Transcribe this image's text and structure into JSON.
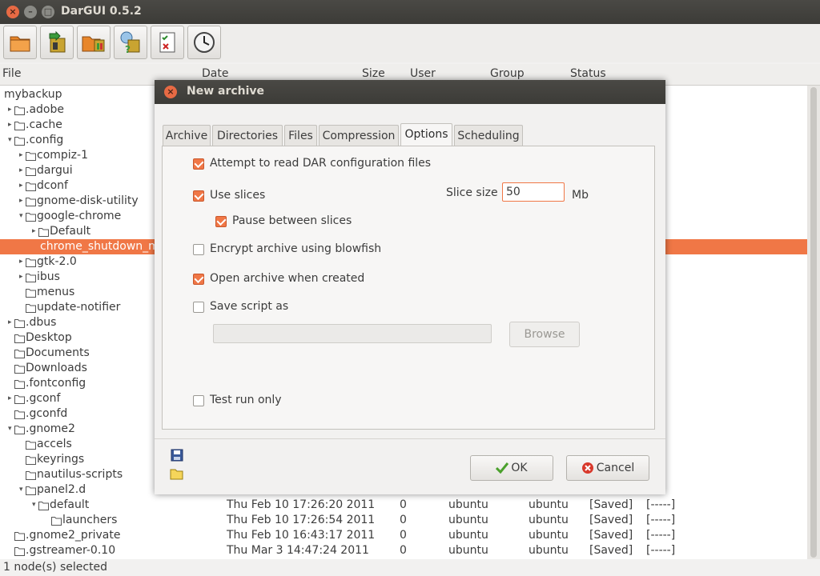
{
  "window": {
    "title": "DarGUI 0.5.2"
  },
  "toolbar": {
    "buttons": [
      "folder-icon",
      "archive-extract-icon",
      "folder-archive-icon",
      "compare-icon",
      "checklist-icon",
      "clock-icon"
    ]
  },
  "columns": {
    "file": "File",
    "date": "Date",
    "size": "Size",
    "user": "User",
    "group": "Group",
    "status": "Status"
  },
  "tree": {
    "root": "mybackup",
    "rows": [
      {
        "name": ".adobe",
        "level": 1,
        "arrow": true
      },
      {
        "name": ".cache",
        "level": 1,
        "arrow": true
      },
      {
        "name": ".config",
        "level": 1,
        "arrow": true,
        "open": true
      },
      {
        "name": "compiz-1",
        "level": 2,
        "arrow": true
      },
      {
        "name": "dargui",
        "level": 2,
        "arrow": true
      },
      {
        "name": "dconf",
        "level": 2,
        "arrow": true
      },
      {
        "name": "gnome-disk-utility",
        "level": 2,
        "arrow": true
      },
      {
        "name": "google-chrome",
        "level": 2,
        "arrow": true,
        "open": true
      },
      {
        "name": "Default",
        "level": 3,
        "arrow": true
      },
      {
        "name": "chrome_shutdown_m",
        "level": 3,
        "arrow": false,
        "selected": true,
        "file": true
      },
      {
        "name": "gtk-2.0",
        "level": 2,
        "arrow": true
      },
      {
        "name": "ibus",
        "level": 2,
        "arrow": true
      },
      {
        "name": "menus",
        "level": 2,
        "arrow": false
      },
      {
        "name": "update-notifier",
        "level": 2,
        "arrow": false
      },
      {
        "name": ".dbus",
        "level": 1,
        "arrow": true
      },
      {
        "name": "Desktop",
        "level": 1,
        "arrow": false
      },
      {
        "name": "Documents",
        "level": 1,
        "arrow": false
      },
      {
        "name": "Downloads",
        "level": 1,
        "arrow": false
      },
      {
        "name": ".fontconfig",
        "level": 1,
        "arrow": false
      },
      {
        "name": ".gconf",
        "level": 1,
        "arrow": true
      },
      {
        "name": ".gconfd",
        "level": 1,
        "arrow": false
      },
      {
        "name": ".gnome2",
        "level": 1,
        "arrow": true,
        "open": true
      },
      {
        "name": "accels",
        "level": 2,
        "arrow": false
      },
      {
        "name": "keyrings",
        "level": 2,
        "arrow": false
      },
      {
        "name": "nautilus-scripts",
        "level": 2,
        "arrow": false
      },
      {
        "name": "panel2.d",
        "level": 2,
        "arrow": true,
        "open": true
      },
      {
        "name": "default",
        "level": 3,
        "arrow": true,
        "open": true,
        "date": "Thu Feb 10 17:26:20 2011",
        "size": "0",
        "user": "ubuntu",
        "group": "ubuntu",
        "status": "[Saved]",
        "flags": "[-----]"
      },
      {
        "name": "launchers",
        "level": 4,
        "arrow": false,
        "date": "Thu Feb 10 17:26:54 2011",
        "size": "0",
        "user": "ubuntu",
        "group": "ubuntu",
        "status": "[Saved]",
        "flags": "[-----]"
      },
      {
        "name": ".gnome2_private",
        "level": 1,
        "arrow": false,
        "date": "Thu Feb 10 16:43:17 2011",
        "size": "0",
        "user": "ubuntu",
        "group": "ubuntu",
        "status": "[Saved]",
        "flags": "[-----]"
      },
      {
        "name": ".gstreamer-0.10",
        "level": 1,
        "arrow": false,
        "date": "Thu Mar  3 14:47:24 2011",
        "size": "0",
        "user": "ubuntu",
        "group": "ubuntu",
        "status": "[Saved]",
        "flags": "[-----]"
      }
    ]
  },
  "statusbar": {
    "text": "1 node(s) selected"
  },
  "dialog": {
    "title": "New archive",
    "tabs": [
      "Archive",
      "Directories",
      "Files",
      "Compression",
      "Options",
      "Scheduling"
    ],
    "active_tab": "Options",
    "options": {
      "read_dar_config": "Attempt to read DAR configuration files",
      "use_slices": "Use slices",
      "slice_size_label": "Slice size",
      "slice_size_value": "50",
      "slice_unit": "Mb",
      "pause_between_slices": "Pause between slices",
      "encrypt": "Encrypt archive using blowfish",
      "open_when_created": "Open archive when created",
      "save_script": "Save script as",
      "browse": "Browse",
      "test_run": "Test run only"
    },
    "buttons": {
      "ok": "OK",
      "cancel": "Cancel"
    }
  },
  "colors": {
    "accent": "#f07746",
    "titlebar": "#3c3b37",
    "background": "#f2f1f0"
  }
}
